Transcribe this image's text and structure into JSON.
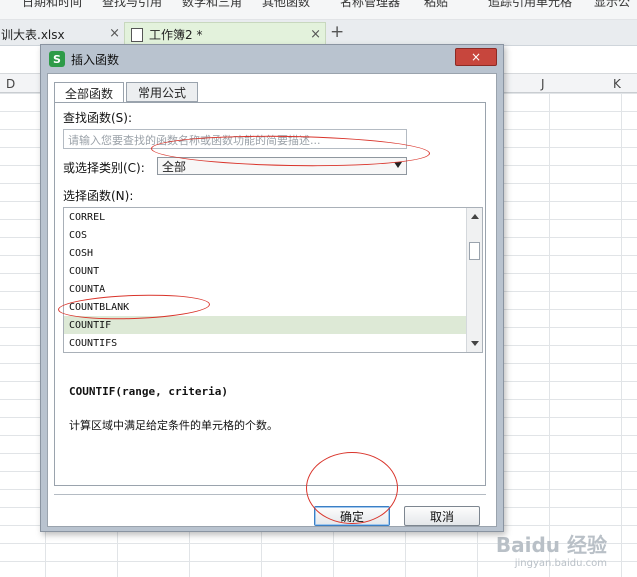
{
  "ribbon": {
    "items": [
      "日期和时间",
      "查找与引用",
      "数学和三角",
      "其他函数",
      "名称管理器",
      "粘贴",
      "追踪引用单元格",
      "显示公"
    ]
  },
  "tabs": [
    {
      "label": "训大表.xlsx",
      "close": "×"
    },
    {
      "label": "工作簿2 *",
      "close": "×"
    }
  ],
  "new_tab": "+",
  "columns": [
    "D",
    "J",
    "K"
  ],
  "dialog": {
    "title": "插入函数",
    "app_icon": "S",
    "close": "×",
    "tabs": [
      "全部函数",
      "常用公式"
    ],
    "search_label": "查找函数(S):",
    "search_placeholder": "请输入您要查找的函数名称或函数功能的简要描述...",
    "category_label": "或选择类别(C):",
    "category_value": "全部",
    "select_label": "选择函数(N):",
    "functions": [
      "CORREL",
      "COS",
      "COSH",
      "COUNT",
      "COUNTA",
      "COUNTBLANK",
      "COUNTIF",
      "COUNTIFS"
    ],
    "selected_function": "COUNTIF",
    "signature": "COUNTIF(range, criteria)",
    "description": "计算区域中满足给定条件的单元格的个数。",
    "ok": "确定",
    "cancel": "取消"
  },
  "watermark": {
    "main": "Baidu 经验",
    "sub": "jingyan.baidu.com"
  },
  "colors": {
    "accent_green": "#2e9b48",
    "close_red": "#c7463d",
    "annotation_red": "#d9342b",
    "selection": "#dde9d6"
  }
}
